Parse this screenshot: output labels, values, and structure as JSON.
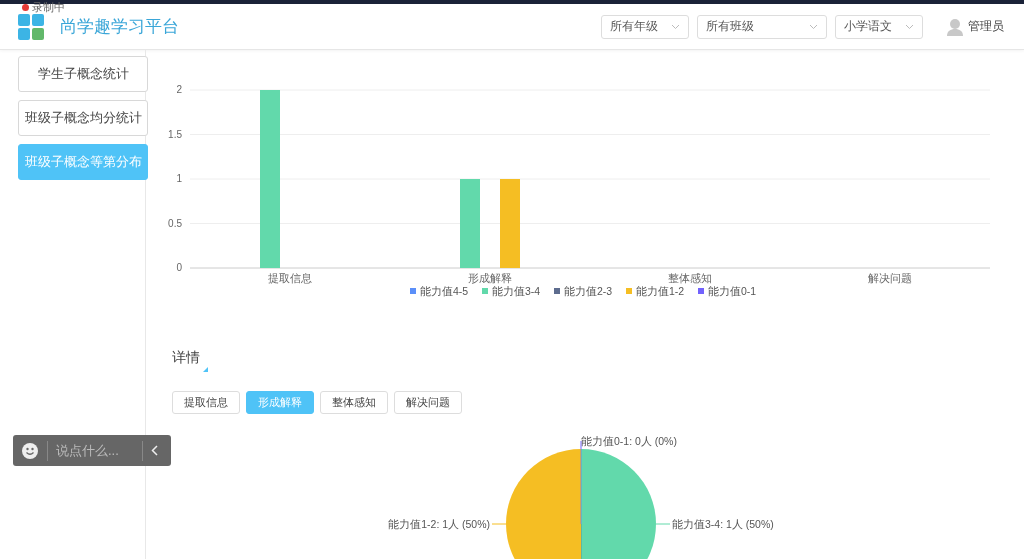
{
  "recording": {
    "label": "录制中"
  },
  "header": {
    "title": "尚学趣学习平台",
    "filters": [
      {
        "value": "所有年级"
      },
      {
        "value": "所有班级"
      },
      {
        "value": "小学语文"
      }
    ],
    "user": "管理员"
  },
  "sidebar": {
    "items": [
      {
        "label": "学生子概念统计",
        "selected": false
      },
      {
        "label": "班级子概念均分统计",
        "selected": false
      },
      {
        "label": "班级子概念等第分布",
        "selected": true
      }
    ]
  },
  "chart": {
    "chart_data": {
      "type": "bar",
      "grid": true,
      "legend": "bottom",
      "categories": [
        "提取信息",
        "形成解释",
        "整体感知",
        "解决问题"
      ],
      "ylim": [
        0,
        2
      ],
      "yticks": [
        0,
        0.5,
        1,
        1.5,
        2
      ],
      "series": [
        {
          "name": "能力值4-5",
          "color": "#5b8ff9",
          "values": [
            0,
            0,
            0,
            0
          ]
        },
        {
          "name": "能力值3-4",
          "color": "#62d9ab",
          "values": [
            2,
            1,
            0,
            0
          ]
        },
        {
          "name": "能力值2-3",
          "color": "#5d6c8e",
          "values": [
            0,
            0,
            0,
            0
          ]
        },
        {
          "name": "能力值1-2",
          "color": "#f5be23",
          "values": [
            0,
            1,
            0,
            0
          ]
        },
        {
          "name": "能力值0-1",
          "color": "#7262fd",
          "values": [
            0,
            0,
            0,
            0
          ]
        }
      ]
    }
  },
  "detail": {
    "title": "详情",
    "tabs": [
      {
        "label": "提取信息",
        "selected": false
      },
      {
        "label": "形成解释",
        "selected": true
      },
      {
        "label": "整体感知",
        "selected": false
      },
      {
        "label": "解决问题",
        "selected": false
      }
    ],
    "chart_data": {
      "type": "pie",
      "values": [
        0,
        1,
        0,
        1,
        0
      ],
      "colors": [
        "#5b8ff9",
        "#62d9ab",
        "#5d6c8e",
        "#f5be23",
        "#7262fd"
      ],
      "value_labels": [
        null,
        "能力值3-4: 1人 (50%)",
        null,
        "能力值1-2: 1人 (50%)",
        "能力值0-1: 0人 (0%)"
      ]
    }
  },
  "chat": {
    "placeholder": "说点什么..."
  }
}
